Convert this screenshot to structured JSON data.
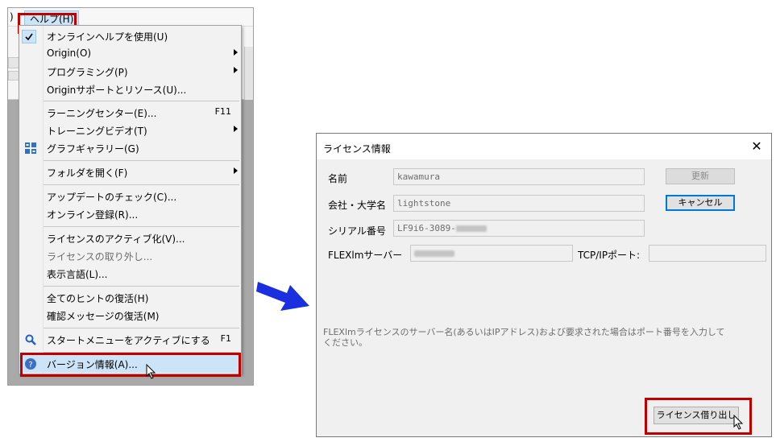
{
  "menu_window": {
    "menubar_fragment": ")",
    "menubar_help": "ヘルプ(H)",
    "items": [
      {
        "label": "オンラインヘルプを使用(U)",
        "shortcut": "",
        "submenu": false,
        "checked": true,
        "icon": "check-icon"
      },
      {
        "label": "Origin(O)",
        "shortcut": "",
        "submenu": true
      },
      {
        "label": "プログラミング(P)",
        "shortcut": "",
        "submenu": true
      },
      {
        "label": "Originサポートとリソース(U)...",
        "shortcut": "",
        "submenu": false
      },
      {
        "label": "ラーニングセンター(E)...",
        "shortcut": "F11",
        "submenu": false
      },
      {
        "label": "トレーニングビデオ(T)",
        "shortcut": "",
        "submenu": true
      },
      {
        "label": "グラフギャラリー(G)",
        "shortcut": "",
        "submenu": false,
        "icon": "graph-gallery-icon"
      },
      {
        "label": "フォルダを開く(F)",
        "shortcut": "",
        "submenu": true
      },
      {
        "label": "アップデートのチェック(C)...",
        "shortcut": "",
        "submenu": false
      },
      {
        "label": "オンライン登録(R)...",
        "shortcut": "",
        "submenu": false
      },
      {
        "label": "ライセンスのアクティブ化(V)...",
        "shortcut": "",
        "submenu": false
      },
      {
        "label": "ライセンスの取り外し...",
        "shortcut": "",
        "submenu": false,
        "disabled": true
      },
      {
        "label": "表示言語(L)...",
        "shortcut": "",
        "submenu": false
      },
      {
        "label": "全てのヒントの復活(H)",
        "shortcut": "",
        "submenu": false
      },
      {
        "label": "確認メッセージの復活(M)",
        "shortcut": "",
        "submenu": false
      },
      {
        "label": "スタートメニューをアクティブにする",
        "shortcut": "F1",
        "submenu": false,
        "icon": "search-icon"
      },
      {
        "label": "バージョン情報(A)...",
        "shortcut": "",
        "submenu": false,
        "icon": "help-circle-icon",
        "highlighted": true
      }
    ]
  },
  "dialog": {
    "title": "ライセンス情報",
    "close_glyph": "✕",
    "fields": {
      "name_label": "名前",
      "name_value": "kawamura",
      "company_label": "会社・大学名",
      "company_value": "lightstone",
      "serial_label": "シリアル番号",
      "serial_value": "LF9i6-3089-",
      "server_label": "FLEXlmサーバー",
      "port_label": "TCP/IPポート:"
    },
    "buttons": {
      "update": "更新",
      "cancel": "キャンセル",
      "borrow": "ライセンス借り出し"
    },
    "hint": "FLEXlmライセンスのサーバー名(あるいはIPアドレス)および要求された場合はポート番号を入力してください。"
  },
  "colors": {
    "highlight_box": "#c00000",
    "arrow": "#1a2fe0",
    "menu_hover": "#cce4f7",
    "focus_border": "#0078d7"
  }
}
